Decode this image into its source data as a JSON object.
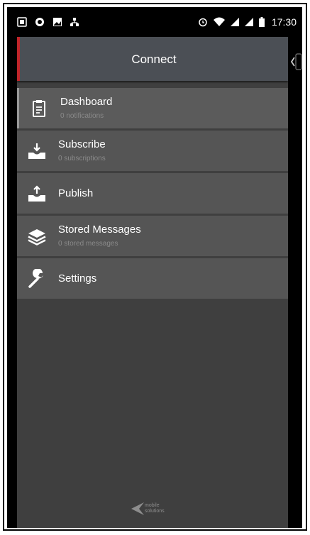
{
  "status_bar": {
    "time": "17:30",
    "left_icons": [
      "sim-icon",
      "sync-icon",
      "image-icon",
      "network-icon"
    ],
    "right_icons": [
      "alarm-icon",
      "wifi-icon",
      "signal-icon",
      "signal-icon",
      "battery-icon"
    ]
  },
  "header": {
    "title": "Connect"
  },
  "menu": [
    {
      "label": "Dashboard",
      "sub": "0 notifications",
      "icon": "clipboard-icon",
      "active": true
    },
    {
      "label": "Subscribe",
      "sub": "0 subscriptions",
      "icon": "inbox-download-icon",
      "active": false
    },
    {
      "label": "Publish",
      "sub": "",
      "icon": "inbox-upload-icon",
      "active": false
    },
    {
      "label": "Stored Messages",
      "sub": "0 stored messages",
      "icon": "layers-icon",
      "active": false
    },
    {
      "label": "Settings",
      "sub": "",
      "icon": "wrench-icon",
      "active": false
    }
  ],
  "footer": {
    "logo_line1": "mobile",
    "logo_line2": "solutions"
  },
  "colors": {
    "accent": "#c0252a",
    "drawer_bg": "#3f3f3f",
    "item_bg": "#555555",
    "header_bg": "#4b4f55"
  }
}
